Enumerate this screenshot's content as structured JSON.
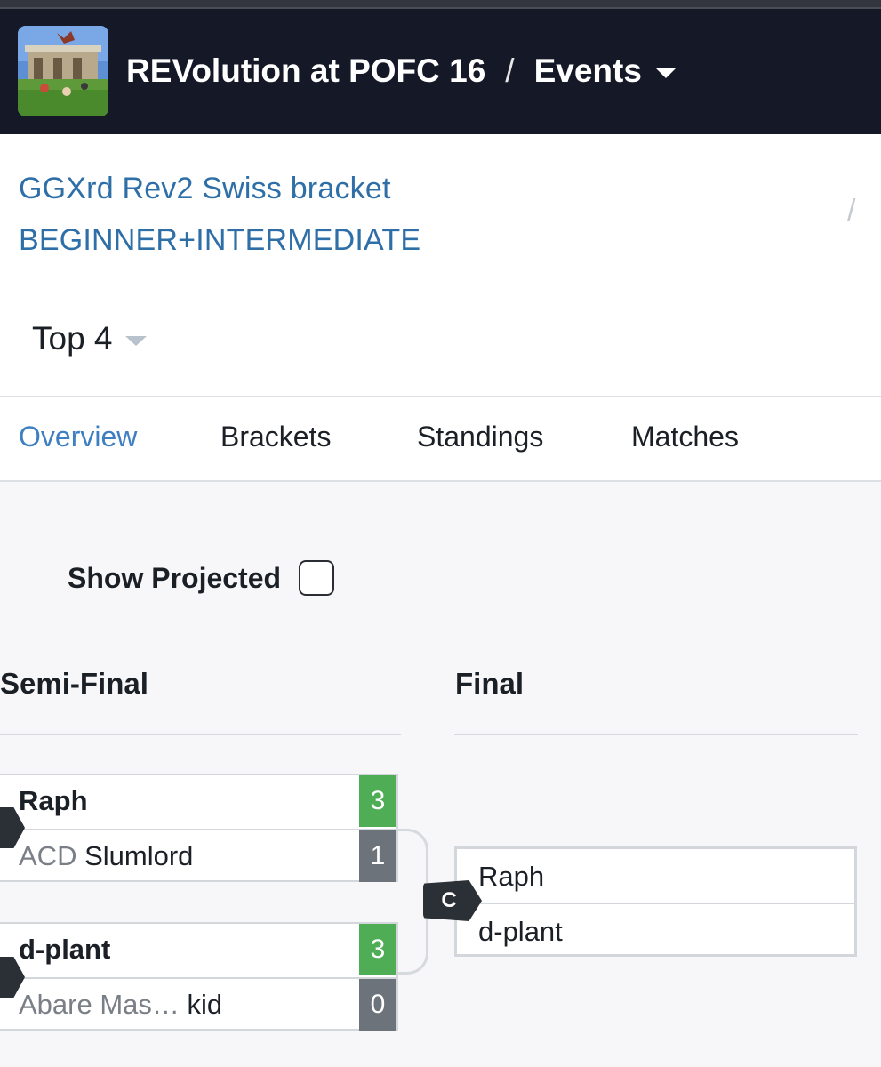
{
  "header": {
    "tournament": "REVolution at POFC 16",
    "separator": "/",
    "events_label": "Events"
  },
  "event": {
    "title_line1": "GGXrd Rev2 Swiss bracket",
    "title_line2": "BEGINNER+INTERMEDIATE",
    "trailing": "/"
  },
  "phase": {
    "label": "Top 4"
  },
  "tabs": [
    {
      "label": "Overview",
      "active": true
    },
    {
      "label": "Brackets",
      "active": false
    },
    {
      "label": "Standings",
      "active": false
    },
    {
      "label": "Matches",
      "active": false
    }
  ],
  "projected": {
    "label": "Show Projected",
    "checked": false
  },
  "rounds": {
    "semi": "Semi-Final",
    "final": "Final"
  },
  "semi_matches": [
    {
      "top": {
        "prefix": "",
        "name": "Raph",
        "score": "3",
        "winner": true
      },
      "bottom": {
        "prefix": "ACD",
        "name": "Slumlord",
        "score": "1",
        "winner": false
      }
    },
    {
      "top": {
        "prefix": "",
        "name": "d-plant",
        "score": "3",
        "winner": true
      },
      "bottom": {
        "prefix": "Abare Mas…",
        "name": "kid",
        "score": "0",
        "winner": false
      }
    }
  ],
  "final_match": {
    "badge": "C",
    "top": "Raph",
    "bottom": "d-plant"
  },
  "colors": {
    "header_bg": "#141827",
    "link_blue": "#2f6fa8",
    "tab_active": "#3d7fc1",
    "win_green": "#4fae55",
    "lose_gray": "#6d737b"
  }
}
